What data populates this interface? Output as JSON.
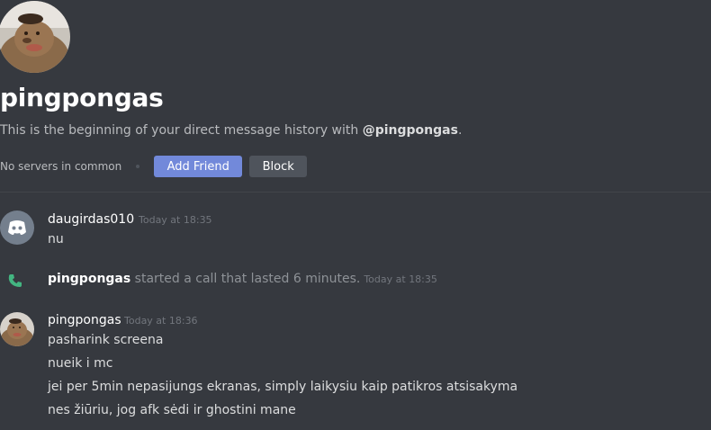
{
  "profile": {
    "name": "pingpongas",
    "intro_prefix": "This is the beginning of your direct message history with ",
    "intro_mention": "@pingpongas",
    "intro_suffix": ".",
    "servers_text": "No servers in common",
    "add_friend_label": "Add Friend",
    "block_label": "Block"
  },
  "messages": [
    {
      "author": "daugirdas010",
      "timestamp": "Today at 18:35",
      "lines": [
        "nu"
      ],
      "avatar_icon": "discord-default-avatar-icon"
    },
    {
      "system": true,
      "author": "pingpongas",
      "text": " started a call that lasted 6 minutes.",
      "timestamp": "Today at 18:35",
      "icon": "phone-icon"
    },
    {
      "author": "pingpongas",
      "timestamp": "Today at 18:36",
      "lines": [
        "pasharink screena",
        "nueik i mc",
        "jei per 5min nepasijungs ekranas, simply laikysiu kaip patikros atsisakyma",
        "nes žiūriu, jog afk sėdi ir ghostini mane"
      ],
      "avatar_icon": "user-avatar-icon"
    }
  ],
  "colors": {
    "background": "#36393f",
    "accent": "#7289da",
    "call_green": "#43b581",
    "muted": "#72767d"
  }
}
